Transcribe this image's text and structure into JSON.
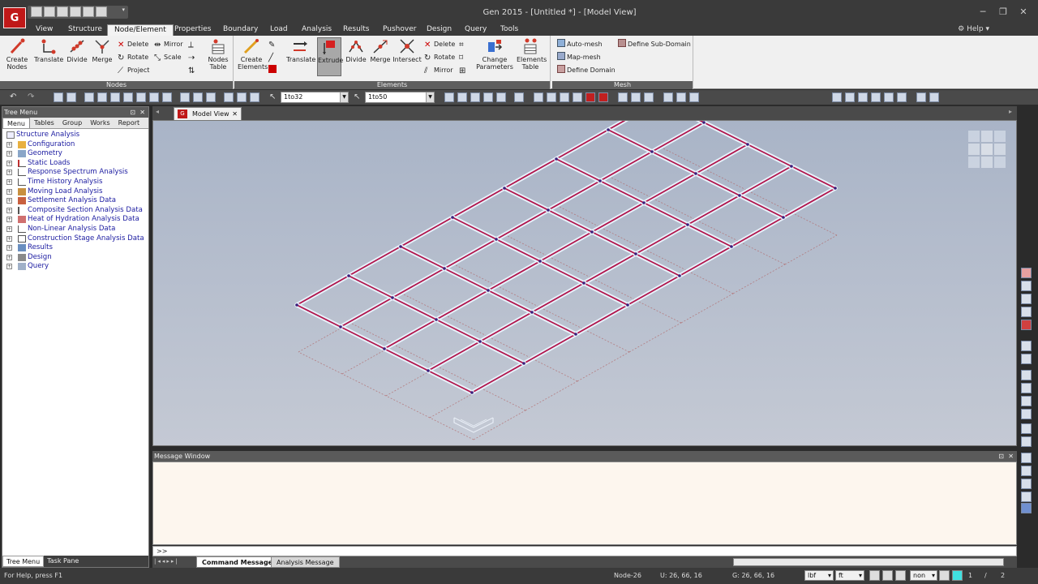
{
  "window": {
    "title": "Gen 2015 - [Untitled *] - [Model View]",
    "logo_text": "G",
    "controls": {
      "minimize": "─",
      "restore": "❐",
      "close": "✕"
    }
  },
  "menu": {
    "tabs": [
      "View",
      "Structure",
      "Node/Element",
      "Properties",
      "Boundary",
      "Load",
      "Analysis",
      "Results",
      "Pushover",
      "Design",
      "Query",
      "Tools"
    ],
    "active": "Node/Element",
    "help_label": "Help"
  },
  "ribbon": {
    "nodes": {
      "label": "Nodes",
      "create_nodes": "Create Nodes",
      "translate": "Translate",
      "divide": "Divide",
      "merge": "Merge",
      "delete": "Delete",
      "rotate": "Rotate",
      "project": "Project",
      "mirror": "Mirror",
      "scale": "Scale",
      "nodes_table": "Nodes Table"
    },
    "elements": {
      "label": "Elements",
      "create_elements": "Create Elements",
      "translate": "Translate",
      "extrude": "Extrude",
      "divide": "Divide",
      "merge": "Merge",
      "intersect": "Intersect",
      "delete": "Delete",
      "rotate": "Rotate",
      "mirror": "Mirror",
      "change_parameters": "Change Parameters",
      "elements_table": "Elements Table"
    },
    "mesh": {
      "label": "Mesh",
      "auto_mesh": "Auto-mesh",
      "map_mesh": "Map-mesh",
      "define_domain": "Define Domain",
      "define_sub_domain": "Define Sub-Domain"
    }
  },
  "toolbar": {
    "node_select": "1to32",
    "element_select": "1to50"
  },
  "tree": {
    "title": "Tree Menu",
    "tabs": [
      "Menu",
      "Tables",
      "Group",
      "Works",
      "Report"
    ],
    "active_tab": "Menu",
    "root": "Structure Analysis",
    "items": [
      "Configuration",
      "Geometry",
      "Static Loads",
      "Response Spectrum Analysis",
      "Time History Analysis",
      "Moving Load Analysis",
      "Settlement Analysis Data",
      "Composite Section Analysis Data",
      "Heat of Hydration Analysis Data",
      "Non-Linear Analysis Data",
      "Construction Stage Analysis Data",
      "Results",
      "Design",
      "Query"
    ],
    "bottom_tabs": [
      "Tree Menu",
      "Task Pane"
    ]
  },
  "model_view": {
    "tab_label": "Model View"
  },
  "message": {
    "title": "Message Window",
    "prompt": ">>",
    "tabs": [
      "Command Message",
      "Analysis Message"
    ]
  },
  "status": {
    "help_text": "For Help, press F1",
    "node": "Node-26",
    "ucs": "U: 26, 66, 16",
    "gcs": "G: 26, 66, 16",
    "force_unit": "lbf",
    "length_unit": "ft",
    "mode": "non",
    "page_current": "1",
    "page_total": "2"
  },
  "colors": {
    "beam": "#b0134a",
    "beam_edge": "#e8f2fb",
    "node": "#3a1d7a",
    "ghost": "#b06060"
  }
}
